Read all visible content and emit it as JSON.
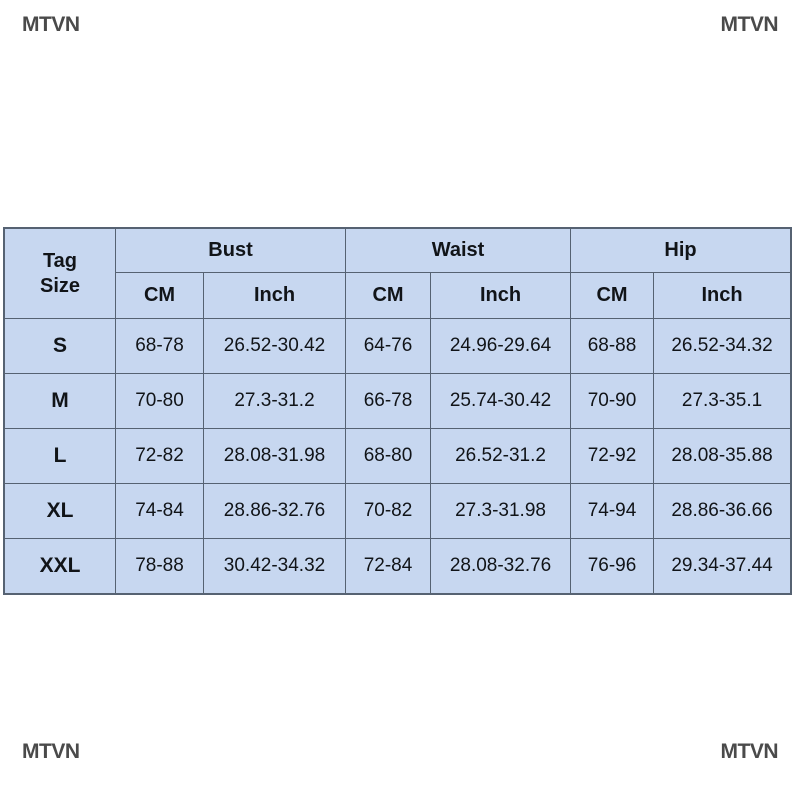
{
  "watermarks": {
    "corner_text": "MTVN",
    "center_text": "MTVN"
  },
  "chart_data": {
    "type": "table",
    "title": "",
    "tag_size_header_line1": "Tag",
    "tag_size_header_line2": "Size",
    "groups": [
      "Bust",
      "Waist",
      "Hip"
    ],
    "units": [
      "CM",
      "Inch"
    ],
    "columns": [
      "Tag Size",
      "Bust CM",
      "Bust Inch",
      "Waist CM",
      "Waist Inch",
      "Hip CM",
      "Hip Inch"
    ],
    "rows": [
      {
        "size": "S",
        "bust_cm": "68-78",
        "bust_inch": "26.52-30.42",
        "waist_cm": "64-76",
        "waist_inch": "24.96-29.64",
        "hip_cm": "68-88",
        "hip_inch": "26.52-34.32"
      },
      {
        "size": "M",
        "bust_cm": "70-80",
        "bust_inch": "27.3-31.2",
        "waist_cm": "66-78",
        "waist_inch": "25.74-30.42",
        "hip_cm": "70-90",
        "hip_inch": "27.3-35.1"
      },
      {
        "size": "L",
        "bust_cm": "72-82",
        "bust_inch": "28.08-31.98",
        "waist_cm": "68-80",
        "waist_inch": "26.52-31.2",
        "hip_cm": "72-92",
        "hip_inch": "28.08-35.88"
      },
      {
        "size": "XL",
        "bust_cm": "74-84",
        "bust_inch": "28.86-32.76",
        "waist_cm": "70-82",
        "waist_inch": "27.3-31.98",
        "hip_cm": "74-94",
        "hip_inch": "28.86-36.66"
      },
      {
        "size": "XXL",
        "bust_cm": "78-88",
        "bust_inch": "30.42-34.32",
        "waist_cm": "72-84",
        "waist_inch": "28.08-32.76",
        "hip_cm": "76-96",
        "hip_inch": "29.34-37.44"
      }
    ],
    "colors": {
      "cell_background": "#c7d7f0",
      "border": "#566272",
      "text": "#111418",
      "page_background": "#ffffff"
    }
  }
}
